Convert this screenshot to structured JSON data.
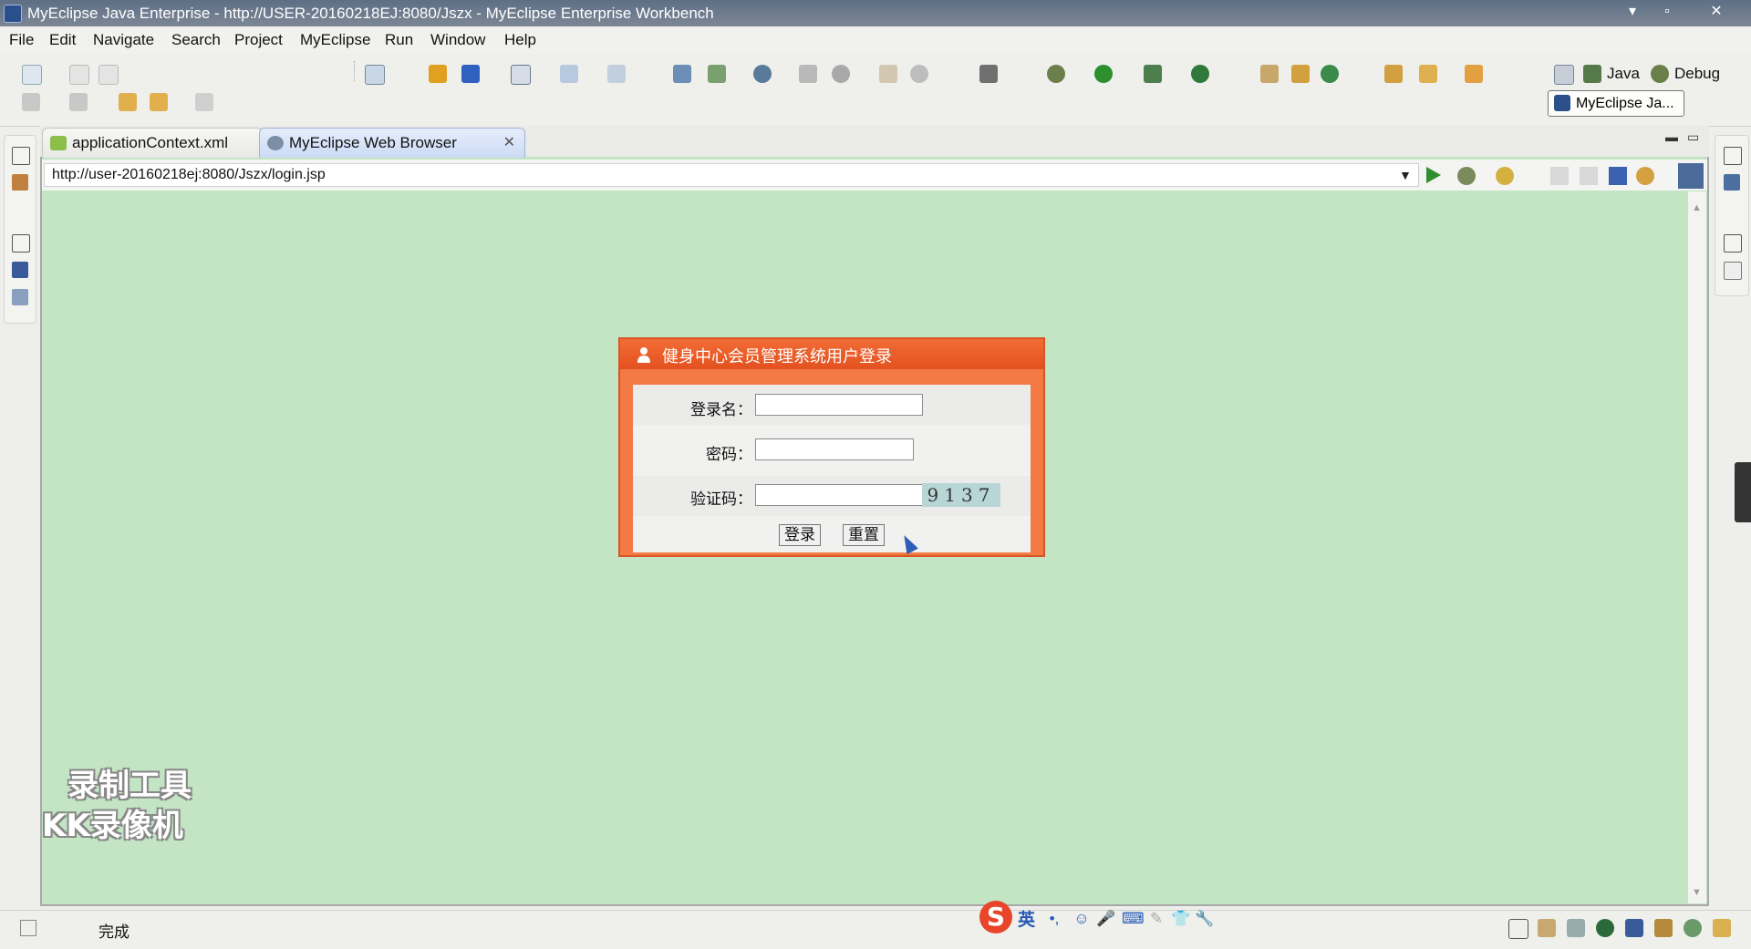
{
  "window": {
    "title": "MyEclipse Java Enterprise - http://USER-20160218EJ:8080/Jszx - MyEclipse Enterprise Workbench",
    "minimize": "▾",
    "restore": "▫",
    "close": "✕"
  },
  "menu": [
    "File",
    "Edit",
    "Navigate",
    "Search",
    "Project",
    "MyEclipse",
    "Run",
    "Window",
    "Help"
  ],
  "perspectives": {
    "java": "Java",
    "debug": "Debug",
    "active": "MyEclipse Ja..."
  },
  "tabs": [
    {
      "label": "applicationContext.xml"
    },
    {
      "label": "MyEclipse Web Browser",
      "close": "✕"
    }
  ],
  "browser": {
    "url": "http://user-20160218ej:8080/Jszx/login.jsp",
    "dropdown": "▼"
  },
  "login": {
    "title": "健身中心会员管理系统用户登录",
    "username_label": "登录名：",
    "password_label": "密码：",
    "captcha_label": "验证码：",
    "username_value": "",
    "password_value": "",
    "captcha_value": "",
    "captcha_code": "9137",
    "login_button": "登录",
    "reset_button": "重置"
  },
  "watermark": {
    "line1": "录制工具",
    "line2": "KK录像机"
  },
  "status": {
    "text": "完成"
  },
  "ime": {
    "logo": "S",
    "mode": "英",
    "punct": "•,",
    "emoji": "☺",
    "mic": "🎤",
    "keyboard": "⌨",
    "tools": "✎",
    "skin": "👕",
    "settings": "🔧"
  },
  "colors": {
    "page_bg": "#c3e5c4",
    "login_border": "#d95524",
    "login_header": "#e3511f",
    "captcha_bg": "#b8d6d6"
  }
}
